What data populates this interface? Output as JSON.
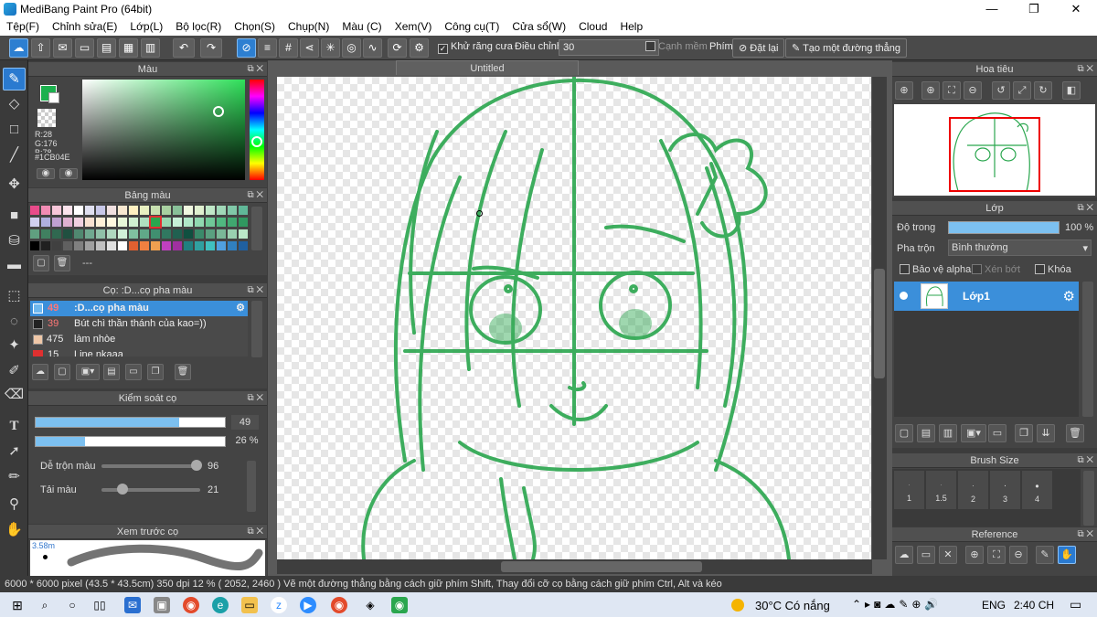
{
  "window": {
    "title": "MediBang Paint Pro (64bit)",
    "min": "—",
    "max": "❐",
    "close": "✕"
  },
  "menu": [
    "Tệp(F)",
    "Chỉnh sửa(E)",
    "Lớp(L)",
    "Bộ lọc(R)",
    "Chọn(S)",
    "Chụp(N)",
    "Màu (C)",
    "Xem(V)",
    "Công cụ(T)",
    "Cửa sổ(W)",
    "Cloud",
    "Help"
  ],
  "toolbar": {
    "antialias_label": "Khử răng cưa",
    "adjust_label": "Điều chỉnh",
    "adjust_value": "30",
    "smooth_label": "Cạnh mềm",
    "key_label": "Phím",
    "reset_label": "Đặt lại",
    "straight_label": "Tạo một đường thẳng"
  },
  "color_panel": {
    "title": "Màu",
    "r": "R:28",
    "g": "G:176",
    "b": "B:78",
    "hex": "#1CB04E",
    "primary": "#1CB04E"
  },
  "palette_panel": {
    "title": "Bảng màu",
    "footer": "---"
  },
  "brush_panel": {
    "title": "Cọ: :D...cọ pha màu",
    "items": [
      {
        "size": "49",
        "name": ":D...cọ pha màu",
        "color": "#6fb8ee",
        "selected": true
      },
      {
        "size": "39",
        "name": "Bút chì thần thánh của kao=))",
        "color": "#222222",
        "selected": false
      },
      {
        "size": "475",
        "name": "làm nhòe",
        "color": "#f0c8a8",
        "selected": false
      },
      {
        "size": "15",
        "name": "Line nkaaa",
        "color": "#e03030",
        "selected": false
      }
    ]
  },
  "brush_control": {
    "title": "Kiểm soát cọ",
    "size_value": "49",
    "size_fraction": 0.76,
    "opacity_value": "26 %",
    "opacity_fraction": 0.26,
    "blend_label": "Dễ trộn màu",
    "blend_value": "96",
    "blend_fraction": 0.96,
    "reload_label": "Tải màu",
    "reload_value": "21",
    "reload_fraction": 0.21
  },
  "preview_panel": {
    "title": "Xem trước cọ",
    "size": "3.58m"
  },
  "canvas": {
    "tab": "Untitled"
  },
  "navigator": {
    "title": "Hoa tiêu"
  },
  "layer_panel": {
    "title": "Lớp",
    "opacity_label": "Độ trong",
    "opacity_value": "100 %",
    "opacity_fraction": 1.0,
    "blend_label": "Pha trộn",
    "blend_value": "Bình thường",
    "protect_alpha": "Bảo vệ alpha",
    "clip": "Xén bớt",
    "lock": "Khóa",
    "layer_name": "Lớp1"
  },
  "brush_size_panel": {
    "title": "Brush Size",
    "sizes": [
      "1",
      "1.5",
      "2",
      "3",
      "4"
    ]
  },
  "reference_panel": {
    "title": "Reference"
  },
  "status": "6000 * 6000 pixel   (43.5 * 43.5cm)   350 dpi   12 %   ( 2052, 2460 )   Vẽ một đường thẳng bằng cách giữ phím Shift, Thay đổi cỡ cọ bằng cách giữ phím Ctrl, Alt và kéo",
  "taskbar": {
    "weather": "30°C  Có nắng",
    "lang": "ENG",
    "time": "2:40 CH"
  },
  "colors": {
    "accent": "#2a7ad0",
    "stroke": "#1CB04E"
  }
}
